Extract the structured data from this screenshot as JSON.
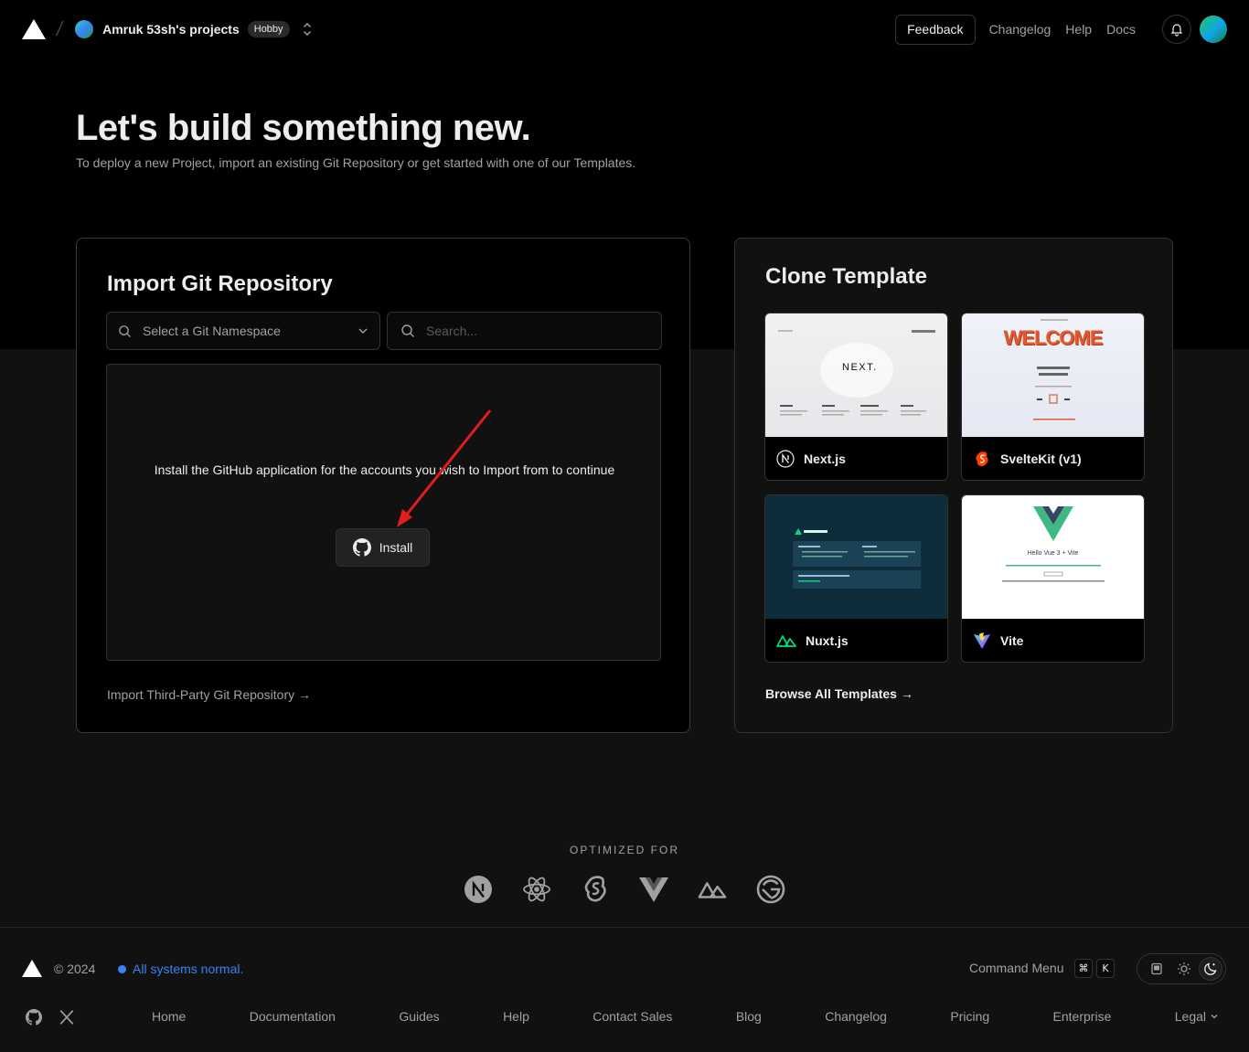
{
  "header": {
    "project_name": "Amruk 53sh's projects",
    "plan_badge": "Hobby",
    "feedback_label": "Feedback",
    "nav": [
      "Changelog",
      "Help",
      "Docs"
    ]
  },
  "hero": {
    "title": "Let's build something new.",
    "subtitle": "To deploy a new Project, import an existing Git Repository or get started with one of our Templates."
  },
  "import": {
    "title": "Import Git Repository",
    "namespace_placeholder": "Select a Git Namespace",
    "search_placeholder": "Search...",
    "install_message": "Install the GitHub application for the accounts you wish to Import from to continue",
    "install_label": "Install",
    "third_party_link": "Import Third-Party Git Repository →"
  },
  "clone": {
    "title": "Clone Template",
    "templates": [
      {
        "name": "Next.js",
        "thumb_text": "NEXT."
      },
      {
        "name": "SvelteKit (v1)",
        "thumb_text": "WELCOME"
      },
      {
        "name": "Nuxt.js",
        "thumb_text": ""
      },
      {
        "name": "Vite",
        "thumb_text": "Hello Vue 3 + Vite"
      }
    ],
    "browse_link": "Browse All Templates →"
  },
  "optimized": {
    "title": "OPTIMIZED FOR",
    "frameworks": [
      "nextjs-icon",
      "react-icon",
      "svelte-icon",
      "vue-icon",
      "nuxt-icon",
      "gatsby-icon"
    ]
  },
  "footer": {
    "copyright": "© 2024",
    "status": "All systems normal.",
    "command_menu": "Command Menu",
    "kbd_cmd": "⌘",
    "kbd_k": "K",
    "links": [
      "Home",
      "Documentation",
      "Guides",
      "Help",
      "Contact Sales",
      "Blog",
      "Changelog",
      "Pricing",
      "Enterprise",
      "Legal"
    ]
  },
  "colors": {
    "background": "#111111",
    "header_bg": "#000000",
    "status_blue": "#3b82f6",
    "arrow_red": "#e11d1d"
  }
}
